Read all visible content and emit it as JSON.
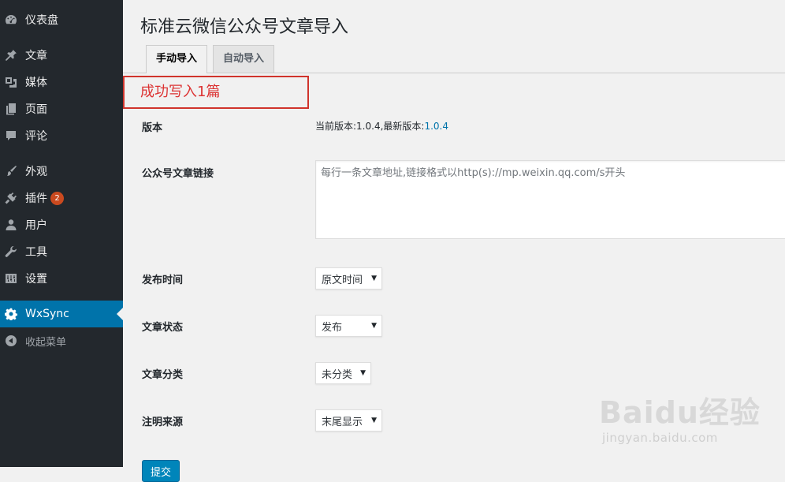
{
  "sidebar": {
    "items": [
      {
        "label": "仪表盘",
        "icon": "dashboard-icon"
      },
      {
        "label": "文章",
        "icon": "pin-icon"
      },
      {
        "label": "媒体",
        "icon": "media-icon"
      },
      {
        "label": "页面",
        "icon": "page-icon"
      },
      {
        "label": "评论",
        "icon": "comment-icon"
      },
      {
        "label": "外观",
        "icon": "brush-icon"
      },
      {
        "label": "插件",
        "icon": "plugin-icon",
        "badge": "2"
      },
      {
        "label": "用户",
        "icon": "user-icon"
      },
      {
        "label": "工具",
        "icon": "wrench-icon"
      },
      {
        "label": "设置",
        "icon": "settings-icon"
      },
      {
        "label": "WxSync",
        "icon": "gear-icon",
        "active": true
      },
      {
        "label": "收起菜单",
        "icon": "collapse-icon"
      }
    ],
    "colors": {
      "background": "#23282d",
      "active": "#0073aa",
      "badge": "#ca4a1f"
    }
  },
  "page": {
    "title": "标准云微信公众号文章导入",
    "tabs": [
      {
        "label": "手动导入",
        "active": true
      },
      {
        "label": "自动导入",
        "active": false
      }
    ],
    "notice": "成功写入1篇",
    "notice_color": "#dc3232"
  },
  "form": {
    "version": {
      "label": "版本",
      "current_text": "当前版本:1.0.4,最新版本:",
      "latest": "1.0.4"
    },
    "links": {
      "label": "公众号文章链接",
      "placeholder": "每行一条文章地址,链接格式以http(s)://mp.weixin.qq.com/s开头"
    },
    "publish_time": {
      "label": "发布时间",
      "selected": "原文时间"
    },
    "post_status": {
      "label": "文章状态",
      "selected": "发布"
    },
    "category": {
      "label": "文章分类",
      "selected": "未分类"
    },
    "source": {
      "label": "注明来源",
      "selected": "末尾显示"
    },
    "submit_label": "提交"
  },
  "watermark": {
    "logo_text": "Baidu经验",
    "url": "jingyan.baidu.com"
  }
}
